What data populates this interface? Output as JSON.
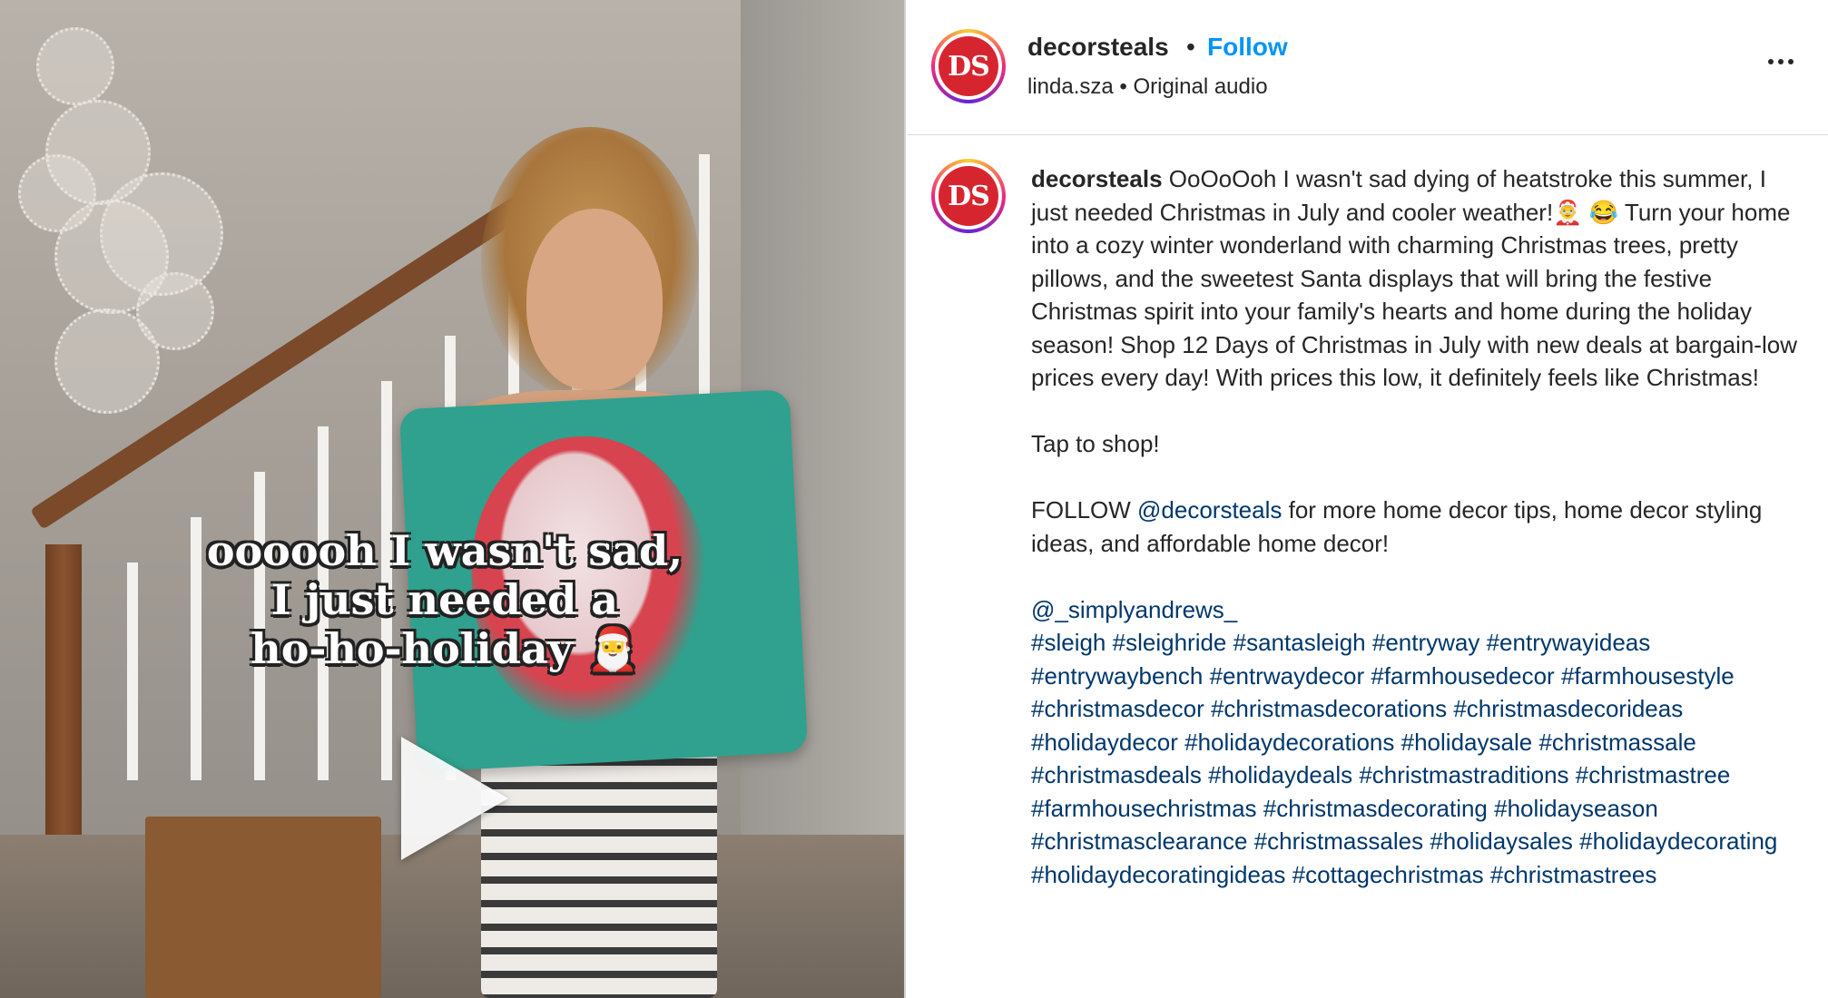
{
  "video": {
    "overlay_lines": [
      "oooooh I wasn't sad,",
      "I just needed a",
      "ho-ho-holiday 🎅"
    ]
  },
  "header": {
    "avatar_text": "DS",
    "username": "decorsteals",
    "separator": "•",
    "follow_label": "Follow",
    "audio_line": "linda.sza • Original audio"
  },
  "caption": {
    "avatar_text": "DS",
    "author": "decorsteals",
    "body": "OoOoOoh I wasn't sad dying of heatstroke this summer, I just needed Christmas in July and cooler weather!🤶 😂 Turn your home into a cozy winter wonderland with charming Christmas trees, pretty pillows, and the sweetest Santa displays that will bring the festive Christmas spirit into your family's hearts and home during the holiday season! Shop 12 Days of Christmas in July with new deals at bargain-low prices every day! With prices this low, it definitely feels like Christmas!",
    "cta": "Tap to shop!",
    "follow_prefix": "FOLLOW ",
    "follow_mention": "@decorsteals",
    "follow_suffix": " for more home decor tips, home decor styling ideas, and affordable home decor!",
    "credit_mention": "@_simplyandrews_",
    "hashtags": [
      "#sleigh",
      "#sleighride",
      "#santasleigh",
      "#entryway",
      "#entrywayideas",
      "#entrywaybench",
      "#entrwaydecor",
      "#farmhousedecor",
      "#farmhousestyle",
      "#christmasdecor",
      "#christmasdecorations",
      "#christmasdecorideas",
      "#holidaydecor",
      "#holidaydecorations",
      "#holidaysale",
      "#christmassale",
      "#christmasdeals",
      "#holidaydeals",
      "#christmastraditions",
      "#christmastree",
      "#farmhousechristmas",
      "#christmasdecorating",
      "#holidayseason",
      "#christmasclearance",
      "#christmassales",
      "#holidaysales",
      "#holidaydecorating",
      "#holidaydecoratingideas",
      "#cottagechristmas",
      "#christmastrees"
    ]
  },
  "colors": {
    "link": "#00376b",
    "follow": "#0095f6",
    "brand": "#d7252f"
  }
}
